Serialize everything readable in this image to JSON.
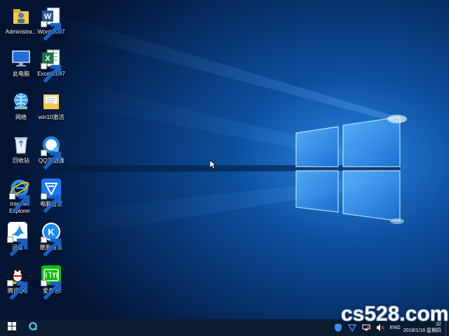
{
  "desktop": {
    "icons": [
      {
        "label": "Administra...",
        "icon": "user-folder-icon"
      },
      {
        "label": "Word 2007",
        "icon": "word-icon"
      },
      {
        "label": "此电脑",
        "icon": "this-pc-icon"
      },
      {
        "label": "Excel 2007",
        "icon": "excel-icon"
      },
      {
        "label": "网络",
        "icon": "network-icon"
      },
      {
        "label": "win10激活",
        "icon": "folder-icon"
      },
      {
        "label": "回收站",
        "icon": "recycle-bin-icon"
      },
      {
        "label": "QQ浏览器",
        "icon": "qq-browser-icon"
      },
      {
        "label": "Internet\nExplorer",
        "icon": "ie-icon"
      },
      {
        "label": "电脑管家",
        "icon": "pc-manager-icon"
      },
      {
        "label": "迅雷",
        "icon": "thunder-icon"
      },
      {
        "label": "酷狗音乐",
        "icon": "kugou-icon"
      },
      {
        "label": "腾讯QQ",
        "icon": "qq-icon"
      },
      {
        "label": "爱奇艺",
        "icon": "iqiyi-icon"
      }
    ]
  },
  "taskbar": {
    "start": "windows-logo-icon",
    "pinned": "qq-browser-icon",
    "tray": {
      "lang": "ENG",
      "time": "32",
      "date": "2018/1/18 星期四"
    }
  },
  "watermark": "cs528.com",
  "colors": {
    "accent": "#1a8cff",
    "taskbar": "#0d1b30"
  }
}
